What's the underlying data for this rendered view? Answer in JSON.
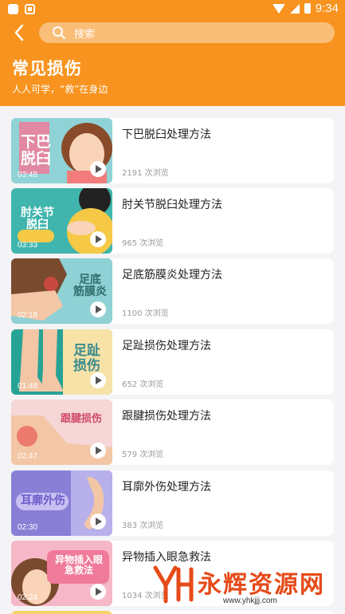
{
  "statusbar": {
    "time": "9:34"
  },
  "header": {
    "search_placeholder": "搜索",
    "title": "常见损伤",
    "subtitle": "人人可学，“救”在身边"
  },
  "items": [
    {
      "title": "下巴脱臼处理方法",
      "views": "2191 次浏览",
      "duration": "03:48",
      "thumb_text": "下巴\n脱臼"
    },
    {
      "title": "肘关节脱臼处理方法",
      "views": "965 次浏览",
      "duration": "03:33",
      "thumb_text": "肘关节\n脱臼"
    },
    {
      "title": "足底筋膜炎处理方法",
      "views": "1100 次浏览",
      "duration": "02:18",
      "thumb_text": "足底\n筋膜炎"
    },
    {
      "title": "足趾损伤处理方法",
      "views": "652 次浏览",
      "duration": "01:48",
      "thumb_text": "足趾\n损伤"
    },
    {
      "title": "跟腱损伤处理方法",
      "views": "579 次浏览",
      "duration": "02:47",
      "thumb_text": "跟腱损伤"
    },
    {
      "title": "耳廓外伤处理方法",
      "views": "383 次浏览",
      "duration": "02:30",
      "thumb_text": "耳廓外伤"
    },
    {
      "title": "异物插入眼急救法",
      "views": "1034 次浏览",
      "duration": "02:24",
      "thumb_text": "异物插入眼\n急救法"
    }
  ],
  "watermark": {
    "text": "永辉资源网",
    "url": "www.yhkjjj.com"
  },
  "colors": {
    "header": "#f7931e",
    "background": "#f4f4f6"
  }
}
